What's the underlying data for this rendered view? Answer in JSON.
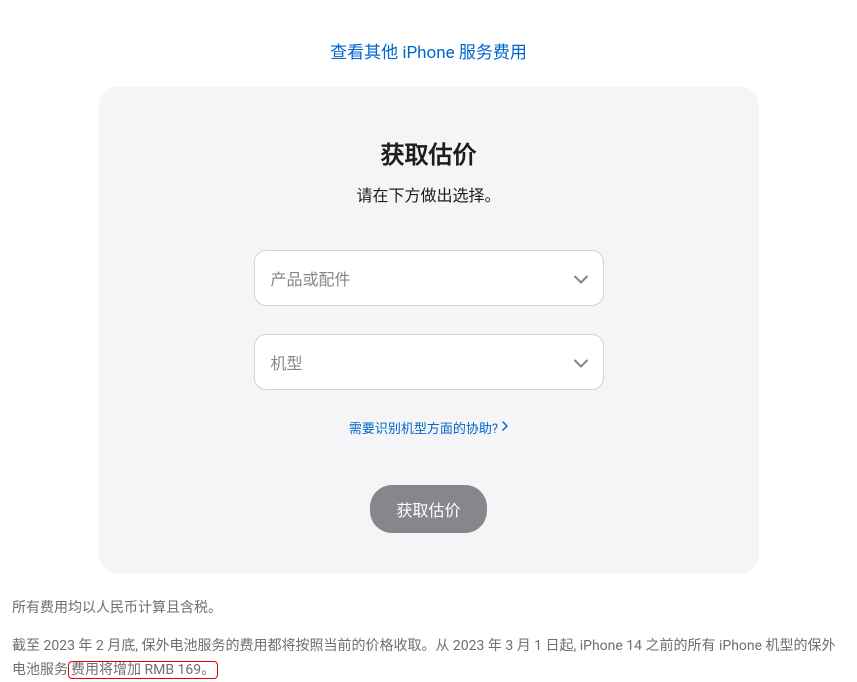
{
  "topLink": {
    "label": "查看其他 iPhone 服务费用"
  },
  "card": {
    "title": "获取估价",
    "subtitle": "请在下方做出选择。",
    "select1": {
      "placeholder": "产品或配件"
    },
    "select2": {
      "placeholder": "机型"
    },
    "helpLink": {
      "label": "需要识别机型方面的协助?"
    },
    "button": {
      "label": "获取估价"
    }
  },
  "footer": {
    "line1": "所有费用均以人民币计算且含税。",
    "line2_a": "截至 2023 年 2 月底, 保外电池服务的费用都将按照当前的价格收取。从 2023 年 3 月 1 日起, iPhone 14 之前的所有 iPhone 机型的保外电池服务",
    "line2_b": "费用将增加 RMB 169。"
  }
}
